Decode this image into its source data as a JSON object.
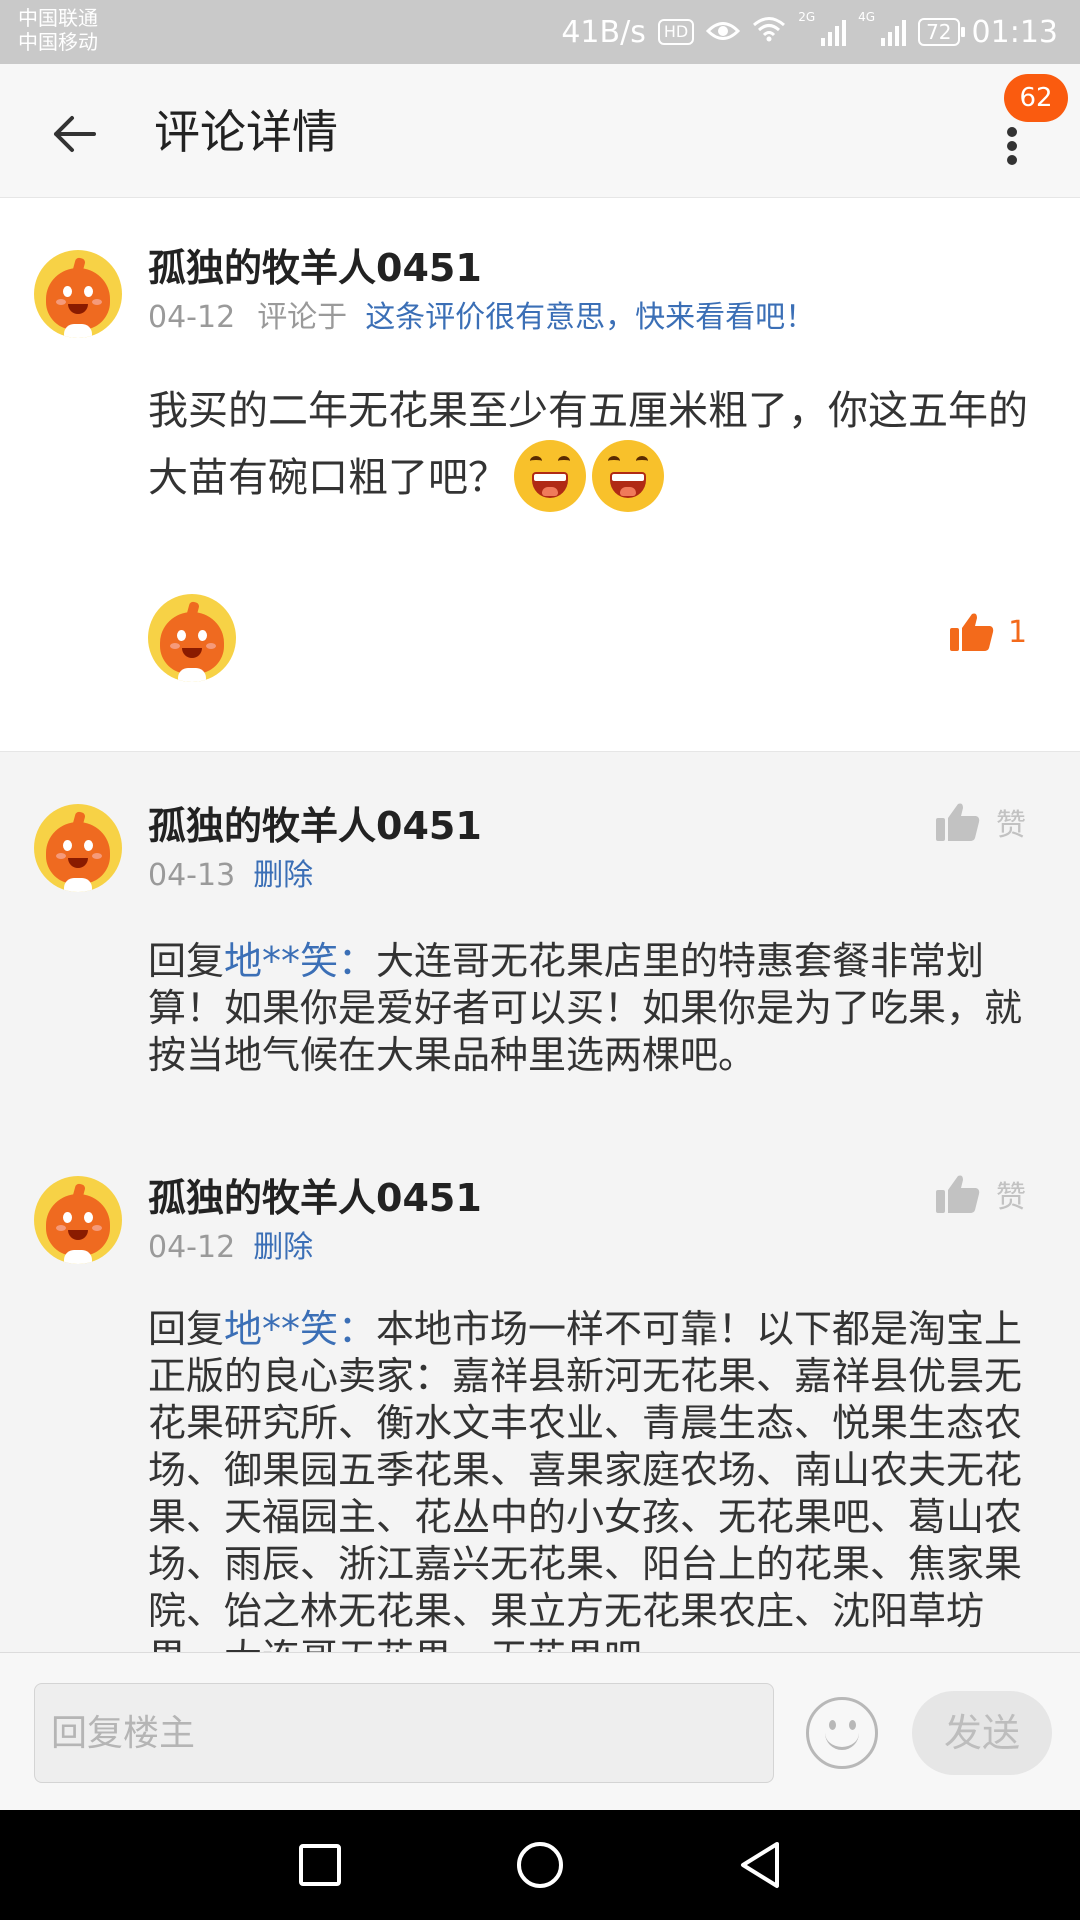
{
  "status_bar": {
    "carrier1": "中国联通",
    "carrier2": "中国移动",
    "speed": "41B/s",
    "hd": "HD",
    "net2g": "2G",
    "net4g": "4G",
    "battery": "72",
    "time": "01:13"
  },
  "header": {
    "title": "评论详情",
    "notification_count": "62",
    "icons": {
      "back": "back-arrow-icon",
      "more": "more-vertical-icon"
    }
  },
  "main_comment": {
    "username": "孤独的牧羊人0451",
    "date": "04-12",
    "comment_on_label": "评论于",
    "link_text": "这条评价很有意思，快来看看吧！",
    "text": "我买的二年无花果至少有五厘米粗了，你这五年的大苗有碗口粗了吧？",
    "emoji_count": 2,
    "like_count": "1",
    "accent_color": "#f36a1b"
  },
  "replies": [
    {
      "username": "孤独的牧羊人0451",
      "date": "04-13",
      "action": "删除",
      "like_label": "赞",
      "reply_prefix": "回复",
      "reply_to": "地**笑：",
      "text": "大连哥无花果店里的特惠套餐非常划算！如果你是爱好者可以买！如果你是为了吃果，就按当地气候在大果品种里选两棵吧。"
    },
    {
      "username": "孤独的牧羊人0451",
      "date": "04-12",
      "action": "删除",
      "like_label": "赞",
      "reply_prefix": "回复",
      "reply_to": "地**笑：",
      "text": "本地市场一样不可靠！以下都是淘宝上正版的良心卖家：嘉祥县新河无花果、嘉祥县优昙无花果研究所、衡水文丰农业、青晨生态、悦果生态农场、御果园五季花果、喜果家庭农场、南山农夫无花果、天福园主、花丛中的小女孩、无花果吧、葛山农场、雨辰、浙江嘉兴无花果、阳台上的花果、焦家果院、饴之林无花果、果立方无花果农庄、沈阳草坊果、大连哥无花果、无花果吧"
    }
  ],
  "input_bar": {
    "placeholder": "回复楼主",
    "send_label": "发送"
  },
  "colors": {
    "link": "#3b6fb6",
    "accent": "#f36a1b",
    "badge": "#fa5b0f"
  }
}
